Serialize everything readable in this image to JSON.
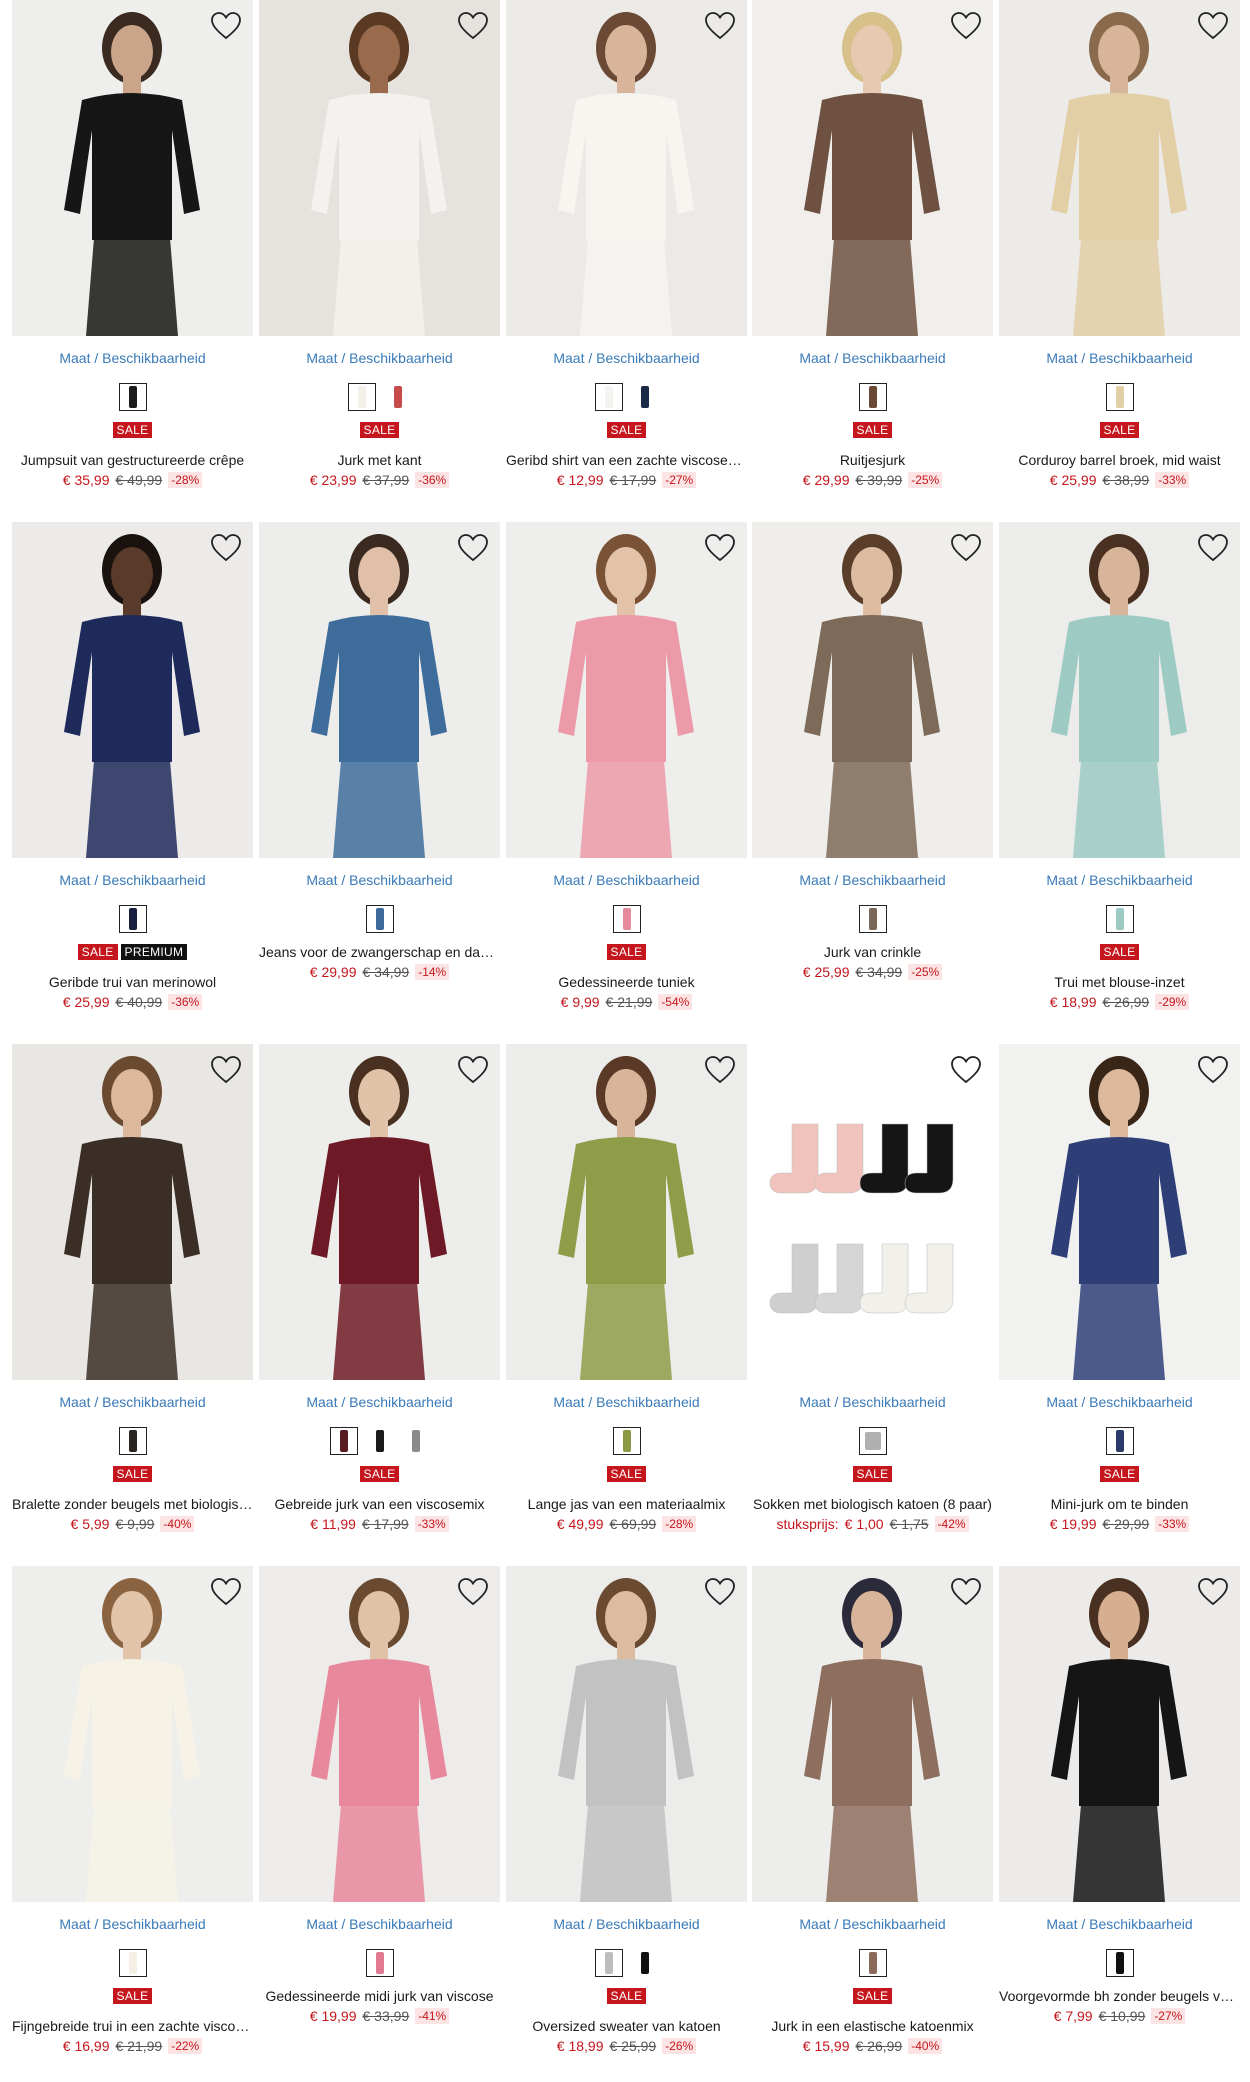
{
  "labels": {
    "size_link": "Maat / Beschikbaarheid",
    "wishlist": "Verlanglijstje"
  },
  "colors": {
    "accent_link": "#3a7ab8",
    "sale": "#c4161c",
    "premium": "#111111",
    "discount_bg": "#fde4e4"
  },
  "products": [
    {
      "title": "Jumpsuit van gestructureerde crêpe",
      "price": "€ 35,99",
      "old_price": "€ 49,99",
      "discount": "-28%",
      "badges": [
        "SALE"
      ],
      "swatches": [
        "#1b1b1b"
      ],
      "bg": "#eeeeec",
      "garment": "#161616",
      "skin": "#caa58a",
      "hair": "#3a2a20"
    },
    {
      "title": "Jurk met kant",
      "price": "€ 23,99",
      "old_price": "€ 37,99",
      "discount": "-36%",
      "badges": [
        "SALE"
      ],
      "swatches": [
        "#f3f0ea",
        "#c84b4b"
      ],
      "bg": "#e6e3df",
      "garment": "#f4f2ee",
      "skin": "#9a6a4c",
      "hair": "#5a3a22"
    },
    {
      "title": "Geribd shirt van een zachte viscosemix",
      "price": "€ 12,99",
      "old_price": "€ 17,99",
      "discount": "-27%",
      "badges": [
        "SALE"
      ],
      "swatches": [
        "#f5f3ef",
        "#1c2a4a"
      ],
      "bg": "#eceae6",
      "garment": "#f7f5f0",
      "skin": "#d8b59a",
      "hair": "#6a4a34"
    },
    {
      "title": "Ruitjesjurk",
      "price": "€ 29,99",
      "old_price": "€ 39,99",
      "discount": "-25%",
      "badges": [
        "SALE"
      ],
      "swatches": [
        "#6a4a36"
      ],
      "bg": "#f1efec",
      "garment": "#6e5140",
      "skin": "#e6c9b0",
      "hair": "#d8c08a"
    },
    {
      "title": "Corduroy barrel broek, mid waist",
      "price": "€ 25,99",
      "old_price": "€ 38,99",
      "discount": "-33%",
      "badges": [
        "SALE"
      ],
      "swatches": [
        "#e3cfa6"
      ],
      "bg": "#ecebe8",
      "garment": "#e3cfa6",
      "skin": "#d8b59a",
      "hair": "#8a6a4c"
    },
    {
      "title": "Geribde trui van merinowol",
      "price": "€ 25,99",
      "old_price": "€ 40,99",
      "discount": "-36%",
      "badges": [
        "SALE",
        "PREMIUM"
      ],
      "swatches": [
        "#17203f"
      ],
      "bg": "#ecebea",
      "garment": "#1e2a5a",
      "skin": "#5a3a2a",
      "hair": "#1a120e"
    },
    {
      "title": "Jeans voor de zwangerschap en daarna",
      "price": "€ 29,99",
      "old_price": "€ 34,99",
      "discount": "-14%",
      "badges": [],
      "swatches": [
        "#3c6a9a"
      ],
      "bg": "#ededec",
      "garment": "#3e6d9c",
      "skin": "#e0c0a8",
      "hair": "#3a2a20"
    },
    {
      "title": "Gedessineerde tuniek",
      "price": "€ 9,99",
      "old_price": "€ 21,99",
      "discount": "-54%",
      "badges": [
        "SALE"
      ],
      "swatches": [
        "#e48a9a"
      ],
      "bg": "#eeeeec",
      "garment": "#ec9aa8",
      "skin": "#e2c2a8",
      "hair": "#7a5236"
    },
    {
      "title": "Jurk van crinkle",
      "price": "€ 25,99",
      "old_price": "€ 34,99",
      "discount": "-25%",
      "badges": [],
      "swatches": [
        "#7a6656"
      ],
      "bg": "#efeeeb",
      "garment": "#7e6a58",
      "skin": "#ddbca2",
      "hair": "#5a3e2a"
    },
    {
      "title": "Trui met blouse-inzet",
      "price": "€ 18,99",
      "old_price": "€ 26,99",
      "discount": "-29%",
      "badges": [
        "SALE"
      ],
      "swatches": [
        "#9cc9c3"
      ],
      "bg": "#ececea",
      "garment": "#9ecac4",
      "skin": "#d8b49a",
      "hair": "#4a3020"
    },
    {
      "title": "Bralette zonder beugels met biologisch katoen",
      "price": "€ 5,99",
      "old_price": "€ 9,99",
      "discount": "-40%",
      "badges": [
        "SALE"
      ],
      "swatches": [
        "#2a2420"
      ],
      "bg": "#e9e7e4",
      "garment": "#3a2e26",
      "skin": "#dcb89c",
      "hair": "#6a4a30"
    },
    {
      "title": "Gebreide jurk van een viscosemix",
      "price": "€ 11,99",
      "old_price": "€ 17,99",
      "discount": "-33%",
      "badges": [
        "SALE"
      ],
      "swatches": [
        "#5a1a22",
        "#1a1a1a",
        "#8a8a8a"
      ],
      "bg": "#ededeb",
      "garment": "#6e1a26",
      "skin": "#e0c2a8",
      "hair": "#4a3020"
    },
    {
      "title": "Lange jas van een materiaalmix",
      "price": "€ 49,99",
      "old_price": "€ 69,99",
      "discount": "-28%",
      "badges": [
        "SALE"
      ],
      "swatches": [
        "#8a9a42"
      ],
      "bg": "#ececea",
      "garment": "#8f9c48",
      "skin": "#d8b49a",
      "hair": "#5a3a26"
    },
    {
      "title": "Sokken met biologisch katoen (8 paar)",
      "price": "€ 1,00",
      "old_price": "€ 1,75",
      "discount": "-42%",
      "unit_label": "stuksprijs:",
      "badges": [
        "SALE"
      ],
      "swatches": [
        "#b0b0b0"
      ],
      "bg": "#ffffff",
      "garment": "#e8b0a8",
      "skin": "#ffffff",
      "hair": "#ffffff"
    },
    {
      "title": "Mini-jurk om te binden",
      "price": "€ 19,99",
      "old_price": "€ 29,99",
      "discount": "-33%",
      "badges": [
        "SALE"
      ],
      "swatches": [
        "#2a3a6a"
      ],
      "bg": "#f1f1f0",
      "garment": "#2e3f78",
      "skin": "#dcb89c",
      "hair": "#3a2616"
    },
    {
      "title": "Fijngebreide trui in een zachte viscosemix",
      "price": "€ 16,99",
      "old_price": "€ 21,99",
      "discount": "-22%",
      "badges": [
        "SALE"
      ],
      "swatches": [
        "#f4efe2"
      ],
      "bg": "#eeeeec",
      "garment": "#f6f2e6",
      "skin": "#e2c4aa",
      "hair": "#8a6440"
    },
    {
      "title": "Gedessineerde midi jurk van viscose",
      "price": "€ 19,99",
      "old_price": "€ 33,99",
      "discount": "-41%",
      "badges": [],
      "swatches": [
        "#e27a94"
      ],
      "bg": "#edecea",
      "garment": "#e8889c",
      "skin": "#e0c2a8",
      "hair": "#6a4a30"
    },
    {
      "title": "Oversized sweater van katoen",
      "price": "€ 18,99",
      "old_price": "€ 25,99",
      "discount": "-26%",
      "badges": [
        "SALE"
      ],
      "swatches": [
        "#bdbdbd",
        "#111111"
      ],
      "bg": "#ececea",
      "garment": "#c2c2c2",
      "skin": "#dcbca0",
      "hair": "#6a4a30"
    },
    {
      "title": "Jurk in een elastische katoenmix",
      "price": "€ 15,99",
      "old_price": "€ 26,99",
      "discount": "-40%",
      "badges": [
        "SALE"
      ],
      "swatches": [
        "#8a6a5a"
      ],
      "bg": "#ededeb",
      "garment": "#8e6e5e",
      "skin": "#d8b49a",
      "hair": "#2a2a3a"
    },
    {
      "title": "Voorgevormde bh zonder beugels van biologisch katoen",
      "price": "€ 7,99",
      "old_price": "€ 10,99",
      "discount": "-27%",
      "badges": [],
      "swatches": [
        "#111111"
      ],
      "bg": "#ecebea",
      "garment": "#151515",
      "skin": "#d6ae90",
      "hair": "#4a3020"
    }
  ]
}
